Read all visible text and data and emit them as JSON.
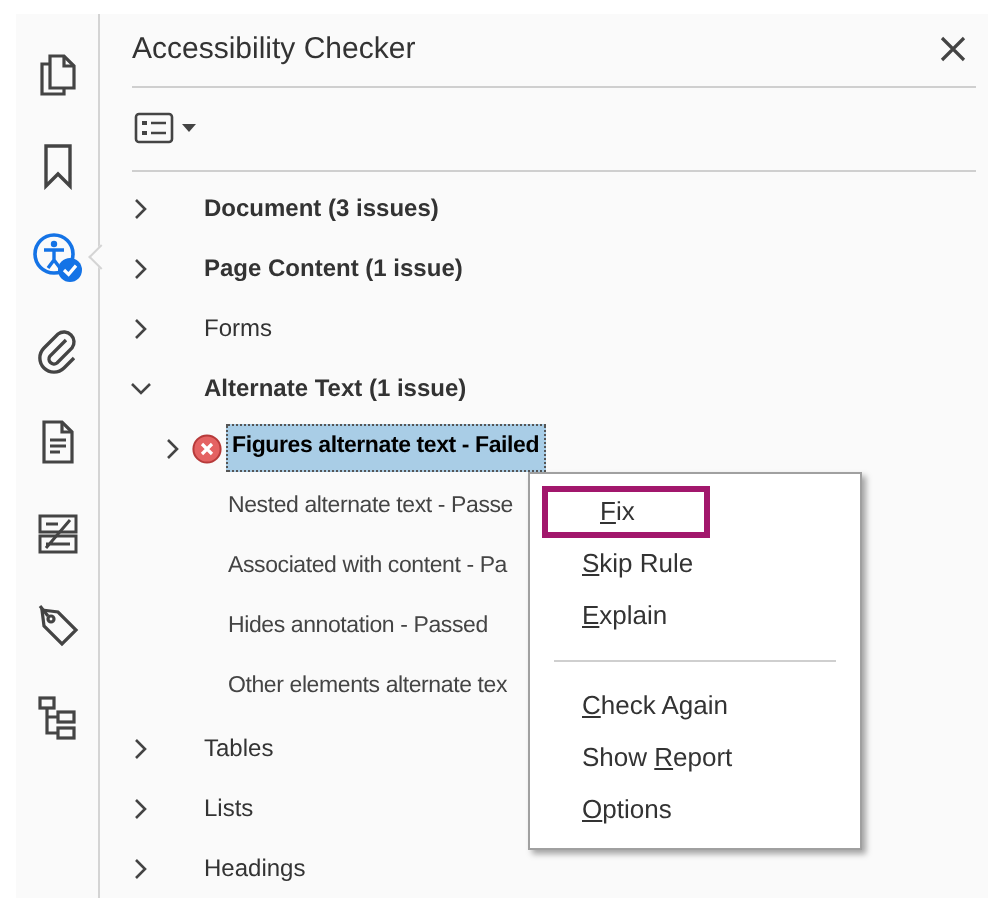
{
  "sidebar": {
    "tools": [
      {
        "kind": "pages",
        "selected": false
      },
      {
        "kind": "bookmark",
        "selected": false
      },
      {
        "kind": "accessibility",
        "selected": true
      },
      {
        "kind": "attachment",
        "selected": false
      },
      {
        "kind": "document",
        "selected": false
      },
      {
        "kind": "compare",
        "selected": false
      },
      {
        "kind": "tag",
        "selected": false
      },
      {
        "kind": "structure",
        "selected": false
      }
    ]
  },
  "panel": {
    "title": "Accessibility Checker",
    "tree": [
      {
        "label": "Document (3 issues)",
        "has_issues": true,
        "expanded": false
      },
      {
        "label": "Page Content (1 issue)",
        "has_issues": true,
        "expanded": false
      },
      {
        "label": "Forms",
        "has_issues": false,
        "expanded": false
      },
      {
        "label": "Alternate Text (1 issue)",
        "has_issues": true,
        "expanded": true,
        "children": [
          {
            "label": "Figures alternate text - Failed",
            "failed": true,
            "expandable": true,
            "selected": true
          },
          {
            "label": "Nested alternate text - Passe",
            "failed": false,
            "expandable": false,
            "selected": false
          },
          {
            "label": "Associated with content - Pa",
            "failed": false,
            "expandable": false,
            "selected": false
          },
          {
            "label": "Hides annotation - Passed",
            "failed": false,
            "expandable": false,
            "selected": false
          },
          {
            "label": "Other elements alternate tex",
            "failed": false,
            "expandable": false,
            "selected": false
          }
        ]
      },
      {
        "label": "Tables",
        "has_issues": false,
        "expanded": false
      },
      {
        "label": "Lists",
        "has_issues": false,
        "expanded": false
      },
      {
        "label": "Headings",
        "has_issues": false,
        "expanded": false
      }
    ]
  },
  "context_menu": {
    "groups": [
      [
        {
          "key": "F",
          "post": "ix",
          "selected": true
        },
        {
          "key": "S",
          "post": "kip Rule",
          "selected": false
        },
        {
          "key": "E",
          "post": "xplain",
          "selected": false
        }
      ],
      [
        {
          "key": "C",
          "post": "heck Again",
          "selected": false
        },
        {
          "pre": "Show ",
          "key": "R",
          "post": "eport",
          "selected": false
        },
        {
          "key": "O",
          "post": "ptions",
          "selected": false
        }
      ]
    ]
  }
}
